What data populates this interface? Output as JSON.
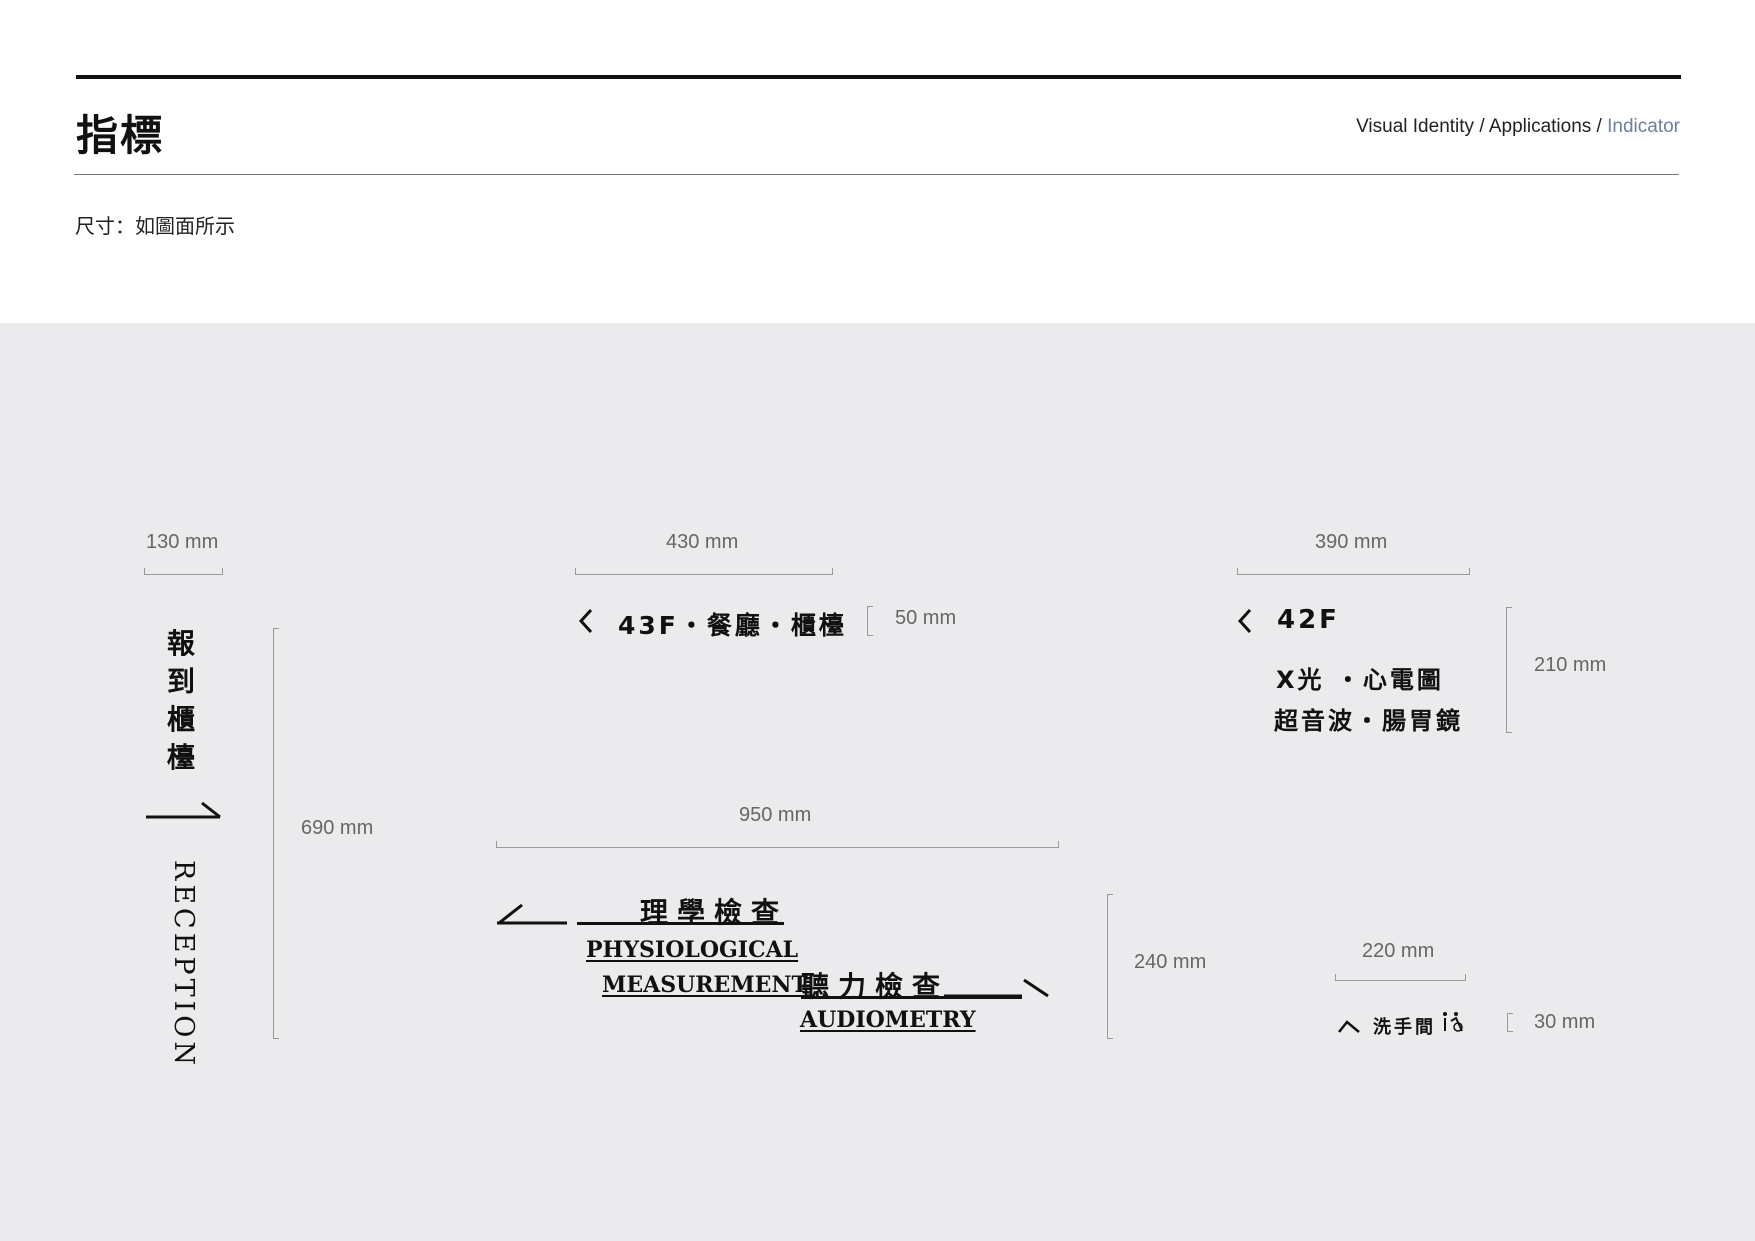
{
  "header": {
    "title": "指標",
    "breadcrumb": {
      "part1": "Visual Identity / ",
      "part2": "Applications / ",
      "current": "Indicator",
      "current_color": "#6f7f9c"
    },
    "subtitle": "尺寸：如圖面所示"
  },
  "panel": {
    "background": "#ebebed"
  },
  "signs": {
    "reception": {
      "width": "130 mm",
      "height": "690 mm",
      "chars": [
        "報",
        "到",
        "櫃",
        "檯"
      ],
      "en": "RECEPTION",
      "arrow_icon": "arrow-right-icon"
    },
    "floor43": {
      "width": "430 mm",
      "height": "50 mm",
      "text": "43F・餐廳・櫃檯",
      "arrow_icon": "chevron-left-icon"
    },
    "floor42": {
      "width": "390 mm",
      "height": "210 mm",
      "floor": "42F",
      "line1": "X光 ・心電圖",
      "line2": "超音波・腸胃鏡",
      "arrow_icon": "chevron-left-icon"
    },
    "physio": {
      "width": "950 mm",
      "height": "240 mm",
      "zh1": "理學檢查",
      "en1a": "PHYSIOLOGICAL",
      "en1b": "MEASUREMENT",
      "zh2": "聽力檢查",
      "en2": "AUDIOMETRY",
      "left_arrow_icon": "arrow-down-left-icon",
      "right_arrow_icon": "arrow-down-right-icon"
    },
    "restroom": {
      "width": "220 mm",
      "height": "30 mm",
      "text": "洗手間",
      "arrow_icon": "chevron-up-icon",
      "person_icon": "restroom-icon"
    }
  }
}
